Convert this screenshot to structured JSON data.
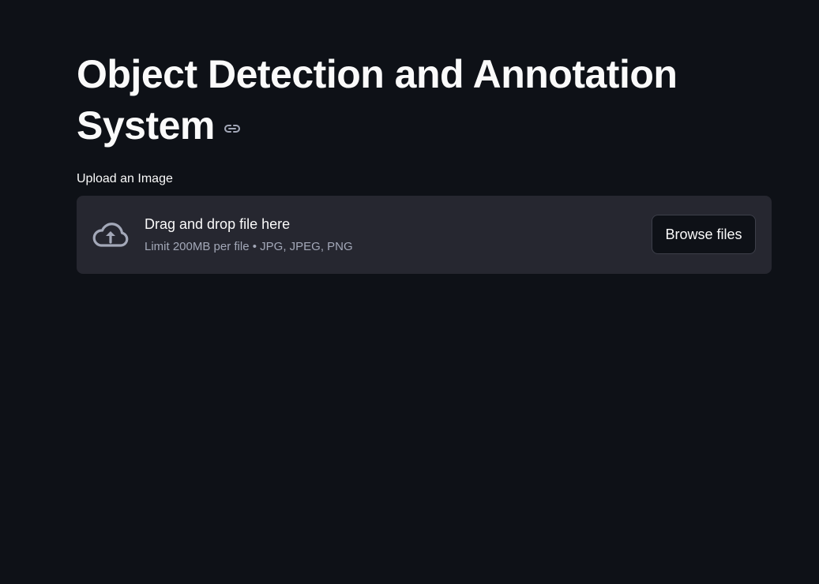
{
  "page": {
    "title": "Object Detection and Annotation System",
    "title_anchor_icon": "link-icon"
  },
  "uploader": {
    "label": "Upload an Image",
    "upload_icon": "cloud-upload-icon",
    "drop_title": "Drag and drop file here",
    "limit_text": "Limit 200MB per file • JPG, JPEG, PNG",
    "browse_label": "Browse files"
  },
  "colors": {
    "background": "#0e1117",
    "dropzone": "#262730",
    "text": "#fafafa",
    "muted_text": "#a3a8b8"
  }
}
